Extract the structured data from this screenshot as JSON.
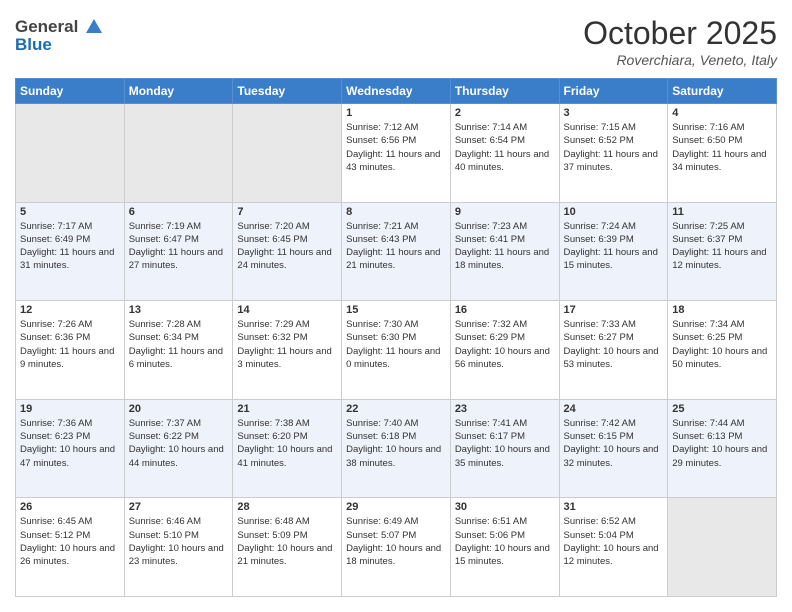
{
  "header": {
    "logo_general": "General",
    "logo_blue": "Blue",
    "month_title": "October 2025",
    "location": "Roverchiara, Veneto, Italy"
  },
  "weekdays": [
    "Sunday",
    "Monday",
    "Tuesday",
    "Wednesday",
    "Thursday",
    "Friday",
    "Saturday"
  ],
  "weeks": [
    [
      {
        "day": "",
        "info": ""
      },
      {
        "day": "",
        "info": ""
      },
      {
        "day": "",
        "info": ""
      },
      {
        "day": "1",
        "info": "Sunrise: 7:12 AM\nSunset: 6:56 PM\nDaylight: 11 hours and 43 minutes."
      },
      {
        "day": "2",
        "info": "Sunrise: 7:14 AM\nSunset: 6:54 PM\nDaylight: 11 hours and 40 minutes."
      },
      {
        "day": "3",
        "info": "Sunrise: 7:15 AM\nSunset: 6:52 PM\nDaylight: 11 hours and 37 minutes."
      },
      {
        "day": "4",
        "info": "Sunrise: 7:16 AM\nSunset: 6:50 PM\nDaylight: 11 hours and 34 minutes."
      }
    ],
    [
      {
        "day": "5",
        "info": "Sunrise: 7:17 AM\nSunset: 6:49 PM\nDaylight: 11 hours and 31 minutes."
      },
      {
        "day": "6",
        "info": "Sunrise: 7:19 AM\nSunset: 6:47 PM\nDaylight: 11 hours and 27 minutes."
      },
      {
        "day": "7",
        "info": "Sunrise: 7:20 AM\nSunset: 6:45 PM\nDaylight: 11 hours and 24 minutes."
      },
      {
        "day": "8",
        "info": "Sunrise: 7:21 AM\nSunset: 6:43 PM\nDaylight: 11 hours and 21 minutes."
      },
      {
        "day": "9",
        "info": "Sunrise: 7:23 AM\nSunset: 6:41 PM\nDaylight: 11 hours and 18 minutes."
      },
      {
        "day": "10",
        "info": "Sunrise: 7:24 AM\nSunset: 6:39 PM\nDaylight: 11 hours and 15 minutes."
      },
      {
        "day": "11",
        "info": "Sunrise: 7:25 AM\nSunset: 6:37 PM\nDaylight: 11 hours and 12 minutes."
      }
    ],
    [
      {
        "day": "12",
        "info": "Sunrise: 7:26 AM\nSunset: 6:36 PM\nDaylight: 11 hours and 9 minutes."
      },
      {
        "day": "13",
        "info": "Sunrise: 7:28 AM\nSunset: 6:34 PM\nDaylight: 11 hours and 6 minutes."
      },
      {
        "day": "14",
        "info": "Sunrise: 7:29 AM\nSunset: 6:32 PM\nDaylight: 11 hours and 3 minutes."
      },
      {
        "day": "15",
        "info": "Sunrise: 7:30 AM\nSunset: 6:30 PM\nDaylight: 11 hours and 0 minutes."
      },
      {
        "day": "16",
        "info": "Sunrise: 7:32 AM\nSunset: 6:29 PM\nDaylight: 10 hours and 56 minutes."
      },
      {
        "day": "17",
        "info": "Sunrise: 7:33 AM\nSunset: 6:27 PM\nDaylight: 10 hours and 53 minutes."
      },
      {
        "day": "18",
        "info": "Sunrise: 7:34 AM\nSunset: 6:25 PM\nDaylight: 10 hours and 50 minutes."
      }
    ],
    [
      {
        "day": "19",
        "info": "Sunrise: 7:36 AM\nSunset: 6:23 PM\nDaylight: 10 hours and 47 minutes."
      },
      {
        "day": "20",
        "info": "Sunrise: 7:37 AM\nSunset: 6:22 PM\nDaylight: 10 hours and 44 minutes."
      },
      {
        "day": "21",
        "info": "Sunrise: 7:38 AM\nSunset: 6:20 PM\nDaylight: 10 hours and 41 minutes."
      },
      {
        "day": "22",
        "info": "Sunrise: 7:40 AM\nSunset: 6:18 PM\nDaylight: 10 hours and 38 minutes."
      },
      {
        "day": "23",
        "info": "Sunrise: 7:41 AM\nSunset: 6:17 PM\nDaylight: 10 hours and 35 minutes."
      },
      {
        "day": "24",
        "info": "Sunrise: 7:42 AM\nSunset: 6:15 PM\nDaylight: 10 hours and 32 minutes."
      },
      {
        "day": "25",
        "info": "Sunrise: 7:44 AM\nSunset: 6:13 PM\nDaylight: 10 hours and 29 minutes."
      }
    ],
    [
      {
        "day": "26",
        "info": "Sunrise: 6:45 AM\nSunset: 5:12 PM\nDaylight: 10 hours and 26 minutes."
      },
      {
        "day": "27",
        "info": "Sunrise: 6:46 AM\nSunset: 5:10 PM\nDaylight: 10 hours and 23 minutes."
      },
      {
        "day": "28",
        "info": "Sunrise: 6:48 AM\nSunset: 5:09 PM\nDaylight: 10 hours and 21 minutes."
      },
      {
        "day": "29",
        "info": "Sunrise: 6:49 AM\nSunset: 5:07 PM\nDaylight: 10 hours and 18 minutes."
      },
      {
        "day": "30",
        "info": "Sunrise: 6:51 AM\nSunset: 5:06 PM\nDaylight: 10 hours and 15 minutes."
      },
      {
        "day": "31",
        "info": "Sunrise: 6:52 AM\nSunset: 5:04 PM\nDaylight: 10 hours and 12 minutes."
      },
      {
        "day": "",
        "info": ""
      }
    ]
  ]
}
